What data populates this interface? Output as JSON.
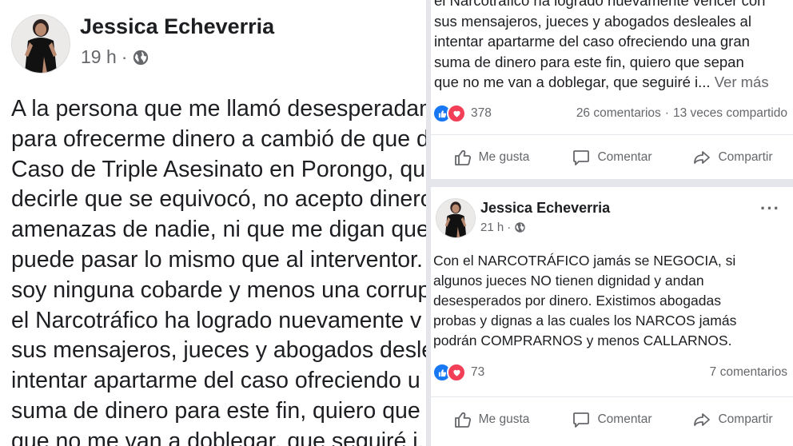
{
  "left_post": {
    "author": "Jessica Echeverria",
    "time": "19 h",
    "separator": "·",
    "audience_icon": "globe-icon",
    "lines": [
      "A la persona que me llamó desesperadam",
      "para ofrecerme dinero a cambió de que d",
      "Caso de Triple Asesinato en Porongo, qu",
      "decirle que se equivocó, no acepto dinero",
      "amenazas de nadie, ni que me digan que",
      "puede pasar lo mismo que al interventor.",
      "soy ninguna cobarde y menos una corrup",
      "el Narcotráfico ha logrado nuevamente v",
      "sus mensajeros, jueces y abogados desle",
      "intentar apartarme del caso ofreciendo u",
      "suma de dinero para este fin, quiero que",
      "que no me van a doblegar, que seguiré i..."
    ]
  },
  "right_top_post": {
    "lines": [
      "el Narcotráfico ha logrado nuevamente vencer con",
      "sus mensajeros, jueces y abogados desleales al",
      "intentar apartarme del caso ofreciendo una gran",
      "suma de dinero para este fin, quiero que sepan"
    ],
    "last_line": "que no me van a doblegar, que seguiré i...",
    "see_more": "Ver más",
    "reactions_count": "378",
    "comments": "26 comentarios",
    "stats_separator": "·",
    "shares": "13 veces compartido",
    "actions": {
      "like": "Me gusta",
      "comment": "Comentar",
      "share": "Compartir"
    }
  },
  "right_bottom_post": {
    "author": "Jessica Echeverria",
    "time": "21 h",
    "separator": "·",
    "audience_icon": "globe-icon",
    "more_icon": "···",
    "lines": [
      "Con el NARCOTRÁFICO jamás se NEGOCIA, si",
      "algunos jueces NO tienen dignidad y andan",
      "desesperados por dinero. Existimos abogadas",
      "probas y dignas a las cuales los NARCOS jamás",
      "podrán COMPRARNOS y menos CALLARNOS."
    ],
    "reactions_count": "73",
    "comments": "7 comentarios",
    "actions": {
      "like": "Me gusta",
      "comment": "Comentar",
      "share": "Compartir"
    }
  },
  "colors": {
    "like_blue": "#1877f2",
    "love_red": "#f33e58",
    "secondary_text": "#65676b",
    "divider": "#e4e6eb"
  }
}
